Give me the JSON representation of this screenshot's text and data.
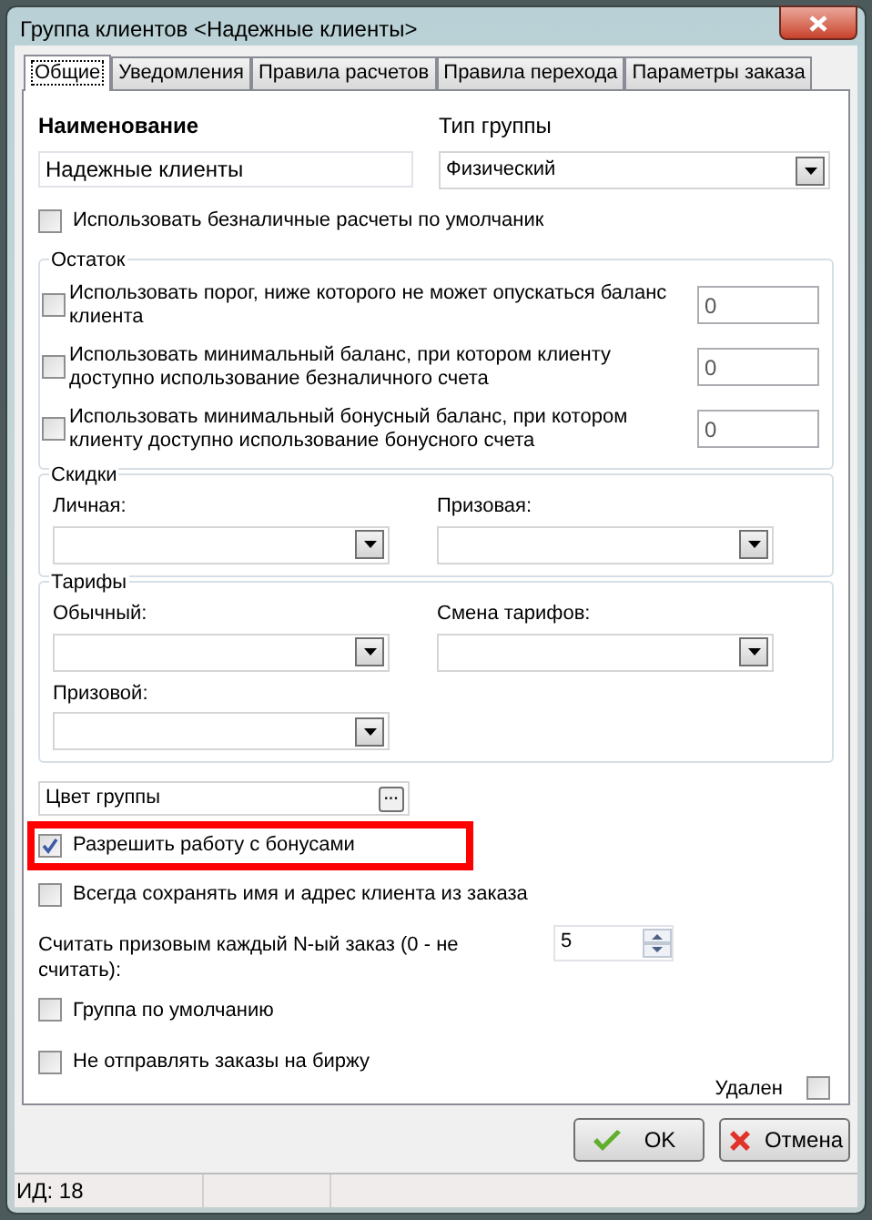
{
  "window": {
    "title": "Группа клиентов <Надежные клиенты>"
  },
  "tabs": [
    {
      "label": "Общие",
      "selected": true
    },
    {
      "label": "Уведомления",
      "selected": false
    },
    {
      "label": "Правила расчетов",
      "selected": false
    },
    {
      "label": "Правила перехода",
      "selected": false
    },
    {
      "label": "Параметры заказа",
      "selected": false
    }
  ],
  "name": {
    "label": "Наименование",
    "value": "Надежные клиенты"
  },
  "group_type": {
    "label": "Тип группы",
    "value": "Физический"
  },
  "cashless_default": {
    "label": "Использовать безналичные расчеты по умолчаник",
    "checked": false
  },
  "balance": {
    "title": "Остаток",
    "rows": [
      {
        "label": "Использовать порог, ниже которого не может опускаться баланс клиента",
        "checked": false,
        "value": "0"
      },
      {
        "label": "Использовать минимальный баланс, при котором клиенту доступно использование безналичного счета",
        "checked": false,
        "value": "0"
      },
      {
        "label": "Использовать минимальный бонусный баланс, при котором клиенту доступно использование бонусного счета",
        "checked": false,
        "value": "0"
      }
    ]
  },
  "discounts": {
    "title": "Скидки",
    "fields": [
      {
        "label": "Личная:"
      },
      {
        "label": "Призовая:"
      }
    ]
  },
  "tariffs": {
    "title": "Тарифы",
    "fields": [
      {
        "label": "Обычный:"
      },
      {
        "label": "Смена тарифов:"
      },
      {
        "label": "Призовой:"
      }
    ]
  },
  "group_color": {
    "placeholder": "Цвет группы",
    "button": "···"
  },
  "bonus": {
    "label": "Разрешить работу с бонусами",
    "checked": true,
    "highlighted": true
  },
  "save_client": {
    "label": "Всегда сохранять имя и адрес клиента из заказа",
    "checked": false
  },
  "prize_order": {
    "label": "Считать призовым каждый N-ый заказ (0 - не считать):",
    "value": "5"
  },
  "default_group": {
    "label": "Группа по умолчанию",
    "checked": false
  },
  "no_exchange": {
    "label": "Не отправлять заказы на биржу",
    "checked": false
  },
  "deleted": {
    "label": "Удален",
    "checked": false
  },
  "buttons": [
    {
      "kind": "ok",
      "label": "OK"
    },
    {
      "kind": "cancel",
      "label": "Отмена"
    }
  ],
  "status_bar": {
    "id": "ИД: 18"
  }
}
